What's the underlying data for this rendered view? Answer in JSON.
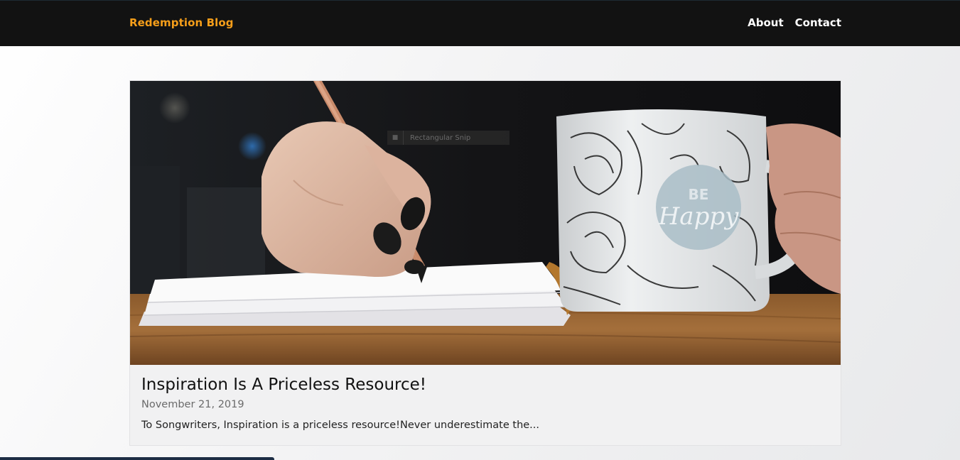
{
  "navbar": {
    "brand": "Redemption Blog",
    "links": [
      "About",
      "Contact"
    ]
  },
  "post": {
    "title": "Inspiration Is A Priceless Resource!",
    "date": "November 21, 2019",
    "excerpt": "To Songwriters, Inspiration is a priceless resource!Never underestimate the..."
  },
  "hero_image": {
    "mug_text_line1": "BE",
    "mug_text_line2": "Happy"
  },
  "overlay": {
    "snip_label": "Rectangular Snip"
  },
  "colors": {
    "navbar_bg": "#121212",
    "brand": "#f59e1a",
    "nav_link": "#ffffff"
  }
}
